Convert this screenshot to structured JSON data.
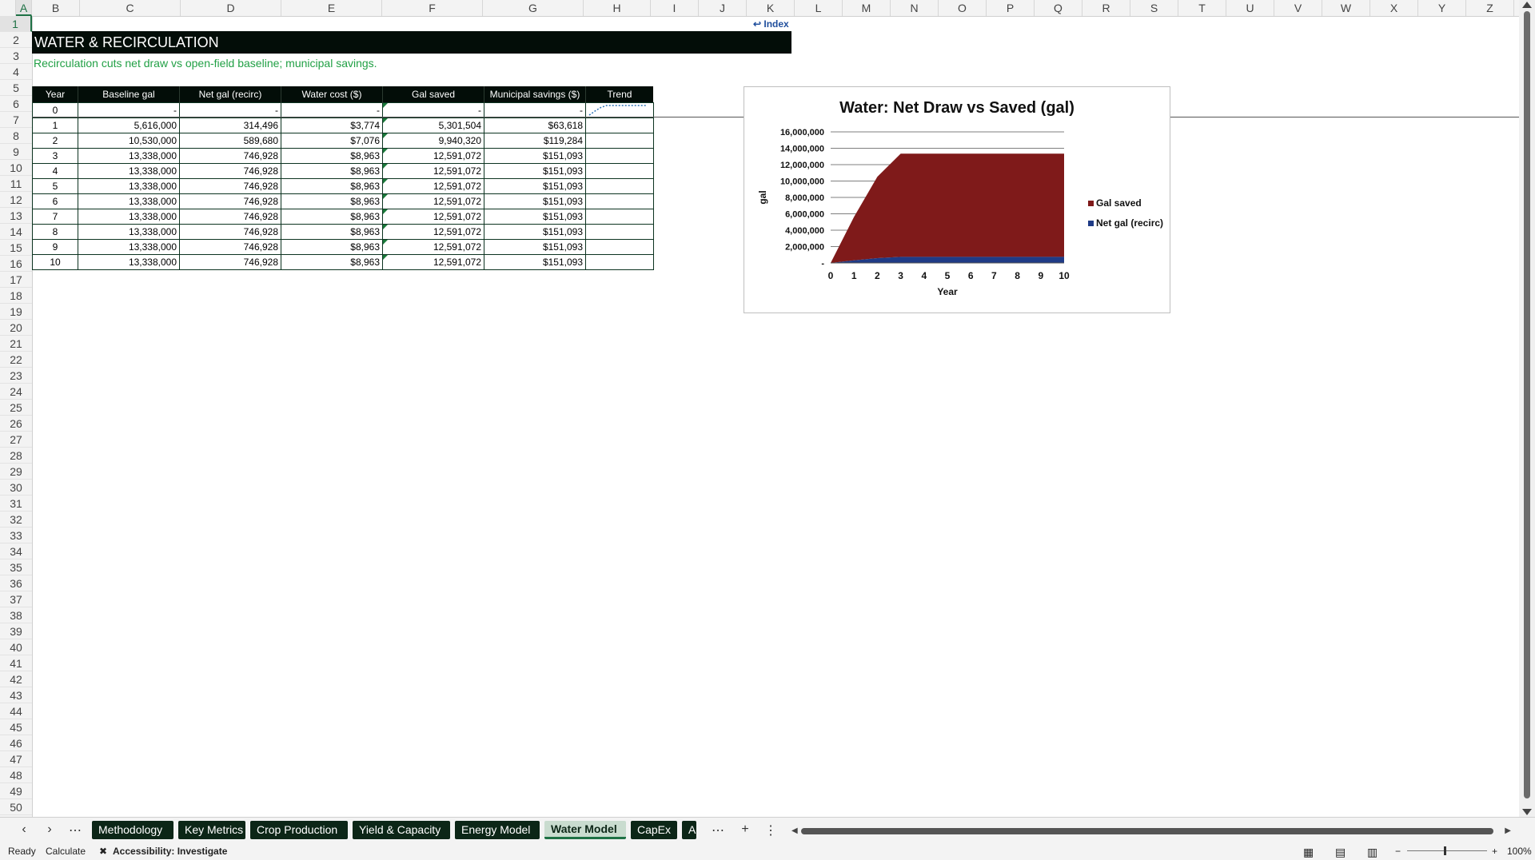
{
  "columns": [
    "A",
    "B",
    "C",
    "D",
    "E",
    "F",
    "G",
    "H",
    "I",
    "J",
    "K",
    "L",
    "M",
    "N",
    "O",
    "P",
    "Q",
    "R",
    "S",
    "T",
    "U",
    "V",
    "W",
    "X",
    "Y",
    "Z"
  ],
  "rows": [
    "1",
    "2",
    "3",
    "4",
    "5",
    "6",
    "7",
    "8",
    "9",
    "10",
    "11",
    "12",
    "13",
    "14",
    "15",
    "16",
    "17",
    "18",
    "19",
    "20",
    "21",
    "22",
    "23",
    "24",
    "25",
    "26",
    "27",
    "28",
    "29",
    "30",
    "31",
    "32",
    "33",
    "34",
    "35",
    "36",
    "37",
    "38",
    "39",
    "40",
    "41",
    "42",
    "43",
    "44",
    "45",
    "46",
    "47",
    "48",
    "49",
    "50"
  ],
  "sheet": {
    "title": "WATER & RECIRCULATION",
    "subtitle": "Recirculation cuts net draw vs open-field baseline; municipal savings.",
    "index_link": "↩ Index"
  },
  "table": {
    "headers": [
      "Year",
      "Baseline gal",
      "Net gal (recirc)",
      "Water cost ($)",
      "Gal saved",
      "Municipal savings ($)",
      "Trend"
    ],
    "rows": [
      [
        "0",
        "-",
        "-",
        "-",
        "-",
        "-",
        ""
      ],
      [
        "1",
        "5,616,000",
        "314,496",
        "$3,774",
        "5,301,504",
        "$63,618",
        ""
      ],
      [
        "2",
        "10,530,000",
        "589,680",
        "$7,076",
        "9,940,320",
        "$119,284",
        ""
      ],
      [
        "3",
        "13,338,000",
        "746,928",
        "$8,963",
        "12,591,072",
        "$151,093",
        ""
      ],
      [
        "4",
        "13,338,000",
        "746,928",
        "$8,963",
        "12,591,072",
        "$151,093",
        ""
      ],
      [
        "5",
        "13,338,000",
        "746,928",
        "$8,963",
        "12,591,072",
        "$151,093",
        ""
      ],
      [
        "6",
        "13,338,000",
        "746,928",
        "$8,963",
        "12,591,072",
        "$151,093",
        ""
      ],
      [
        "7",
        "13,338,000",
        "746,928",
        "$8,963",
        "12,591,072",
        "$151,093",
        ""
      ],
      [
        "8",
        "13,338,000",
        "746,928",
        "$8,963",
        "12,591,072",
        "$151,093",
        ""
      ],
      [
        "9",
        "13,338,000",
        "746,928",
        "$8,963",
        "12,591,072",
        "$151,093",
        ""
      ],
      [
        "10",
        "13,338,000",
        "746,928",
        "$8,963",
        "12,591,072",
        "$151,093",
        ""
      ]
    ]
  },
  "chart_data": {
    "type": "area",
    "title": "Water: Net Draw vs Saved (gal)",
    "xlabel": "Year",
    "ylabel": "gal",
    "x": [
      0,
      1,
      2,
      3,
      4,
      5,
      6,
      7,
      8,
      9,
      10
    ],
    "series": [
      {
        "name": "Gal saved",
        "values": [
          0,
          5301504,
          9940320,
          12591072,
          12591072,
          12591072,
          12591072,
          12591072,
          12591072,
          12591072,
          12591072
        ],
        "color": "#7f1a1a"
      },
      {
        "name": "Net gal (recirc)",
        "values": [
          0,
          314496,
          589680,
          746928,
          746928,
          746928,
          746928,
          746928,
          746928,
          746928,
          746928
        ],
        "color": "#1f3b86"
      }
    ],
    "stacked": true,
    "ylim": [
      0,
      16000000
    ],
    "ytick_labels": [
      "-",
      "2,000,000",
      "4,000,000",
      "6,000,000",
      "8,000,000",
      "10,000,000",
      "12,000,000",
      "14,000,000",
      "16,000,000"
    ],
    "xtick_labels": [
      "0",
      "1",
      "2",
      "3",
      "4",
      "5",
      "6",
      "7",
      "8",
      "9",
      "10"
    ],
    "legend_position": "right",
    "grid": true
  },
  "sparkline_color": "#2e75b6",
  "tabs": [
    "Methodology",
    "Key Metrics",
    "Crop Production",
    "Yield & Capacity",
    "Energy Model",
    "Water Model",
    "CapEx",
    "A"
  ],
  "active_tab": "Water Model",
  "status": {
    "ready": "Ready",
    "calculate": "Calculate",
    "accessibility": "Accessibility: Investigate",
    "zoom": "100%"
  },
  "icons": {
    "prev": "chevron-left-icon",
    "next": "chevron-right-icon",
    "more": "more-icon",
    "add": "plus-icon",
    "options": "vertical-dots-icon"
  }
}
